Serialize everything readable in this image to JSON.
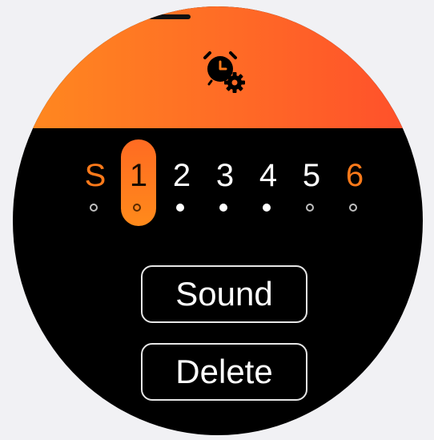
{
  "days": [
    {
      "label": "S",
      "color": "orange",
      "selected": false,
      "indicator": "hollow"
    },
    {
      "label": "1",
      "color": "white",
      "selected": true,
      "indicator": "hollow"
    },
    {
      "label": "2",
      "color": "white",
      "selected": false,
      "indicator": "filled"
    },
    {
      "label": "3",
      "color": "white",
      "selected": false,
      "indicator": "filled"
    },
    {
      "label": "4",
      "color": "white",
      "selected": false,
      "indicator": "filled"
    },
    {
      "label": "5",
      "color": "white",
      "selected": false,
      "indicator": "hollow"
    },
    {
      "label": "6",
      "color": "orange",
      "selected": false,
      "indicator": "hollow"
    }
  ],
  "buttons": {
    "sound_label": "Sound",
    "delete_label": "Delete"
  },
  "icons": {
    "header_icon": "alarm-clock-settings-icon"
  },
  "colors": {
    "accent_start": "#ff8a1f",
    "accent_end": "#ff4e2b",
    "weekend": "#ff7a1a",
    "background": "#000000"
  }
}
